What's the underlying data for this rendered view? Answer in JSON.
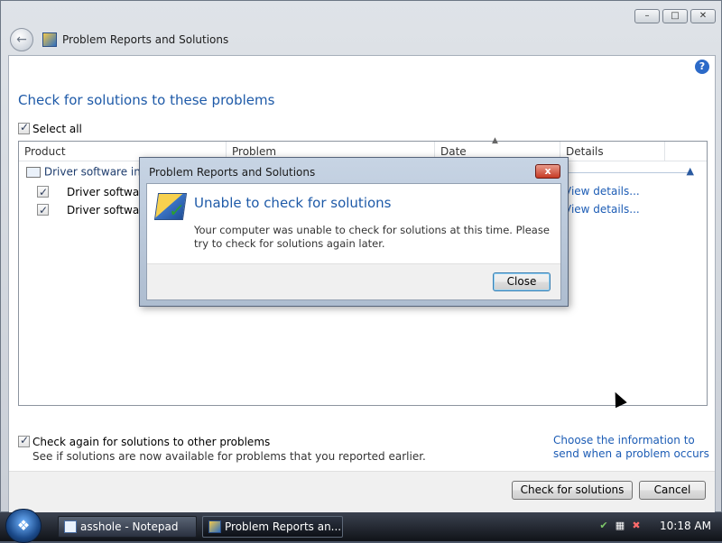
{
  "window": {
    "title": "Problem Reports and Solutions",
    "caption_buttons": [
      "–",
      "□",
      "✕"
    ]
  },
  "main": {
    "heading": "Check for solutions to these problems",
    "select_all_label": "Select all",
    "columns": [
      "Product",
      "Problem",
      "Date",
      "Details"
    ],
    "group_label": "Driver software insta",
    "rows": [
      {
        "product": "Driver software",
        "details": "View details..."
      },
      {
        "product": "Driver software",
        "details": "View details..."
      }
    ],
    "check_again_label": "Check again for solutions to other problems",
    "check_again_sub": "See if solutions are now available for problems that you reported earlier.",
    "info_link": "Choose the information to send when a problem occurs",
    "check_button": "Check for solutions",
    "cancel_button": "Cancel",
    "help_glyph": "?"
  },
  "dialog": {
    "title": "Problem Reports and Solutions",
    "heading": "Unable to check for solutions",
    "message": "Your computer was unable to check for solutions at this time.  Please try to check for solutions again later.",
    "close_button": "Close",
    "close_glyph": "x"
  },
  "taskbar": {
    "tasks": [
      {
        "label": "asshole - Notepad",
        "active": false
      },
      {
        "label": "Problem Reports an...",
        "active": true
      }
    ],
    "clock": "10:18 AM"
  },
  "colors": {
    "heading_blue": "#1e5aa8",
    "link_blue": "#1c5cb5",
    "dialog_close_red": "#c63a24"
  },
  "icons": [
    "back-arrow-icon",
    "problem-reports-icon",
    "help-icon",
    "windows-start-icon",
    "notepad-icon",
    "network-icon",
    "volume-muted-icon",
    "security-shield-icon"
  ]
}
